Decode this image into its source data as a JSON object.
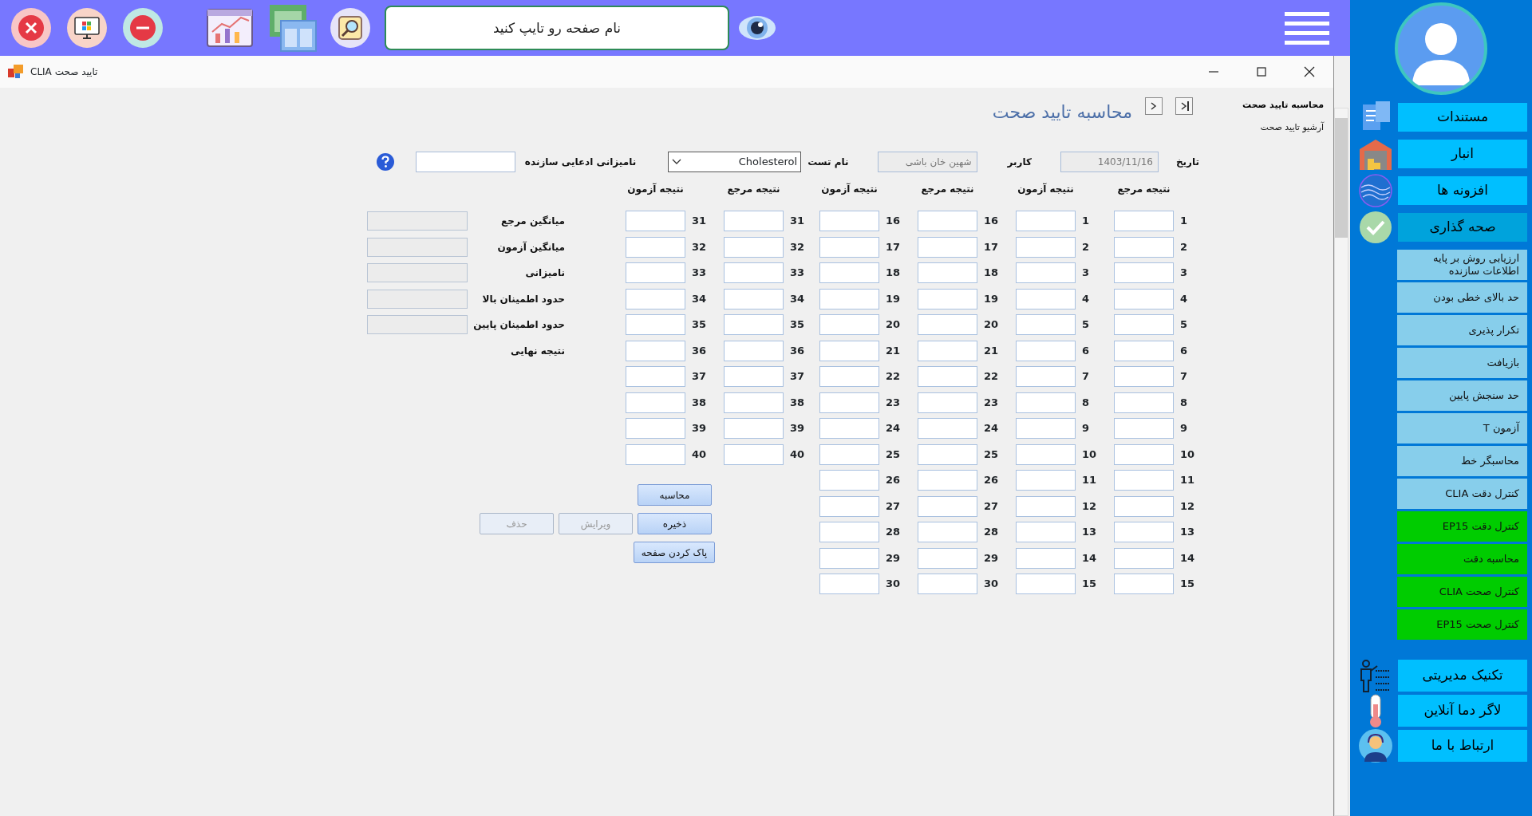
{
  "top_bar": {
    "search": {
      "placeholder": "نام صفحه رو تایپ کنید"
    }
  },
  "window": {
    "title": "تایید صحت CLIA"
  },
  "side_links": [
    {
      "label": "محاسبه تایید صحت",
      "selected": true
    },
    {
      "label": "آرشیو تایید صحت",
      "selected": false
    }
  ],
  "page_title": "محاسبه تایید صحت",
  "fields": [
    {
      "label": "تاریخ",
      "value": "1403/11/16",
      "kind": "text",
      "disabled": true
    },
    {
      "label": "کاربر",
      "value": "شهین خان باشی",
      "kind": "text",
      "disabled": true
    },
    {
      "label": "نام تست",
      "value": "Cholesterol",
      "kind": "dropdown"
    },
    {
      "label": "نامیزانی ادعایی سازنده",
      "kind": "text",
      "disabled": false
    }
  ],
  "result_columns": [
    {
      "header": "نتیجه مرجع",
      "rows": [
        "1",
        "2",
        "3",
        "4",
        "5",
        "6",
        "7",
        "8",
        "9",
        "10",
        "11",
        "12",
        "13",
        "14",
        "15"
      ]
    },
    {
      "header": "نتیجه آزمون",
      "rows": [
        "1",
        "2",
        "3",
        "4",
        "5",
        "6",
        "7",
        "8",
        "9",
        "10",
        "11",
        "12",
        "13",
        "14",
        "15"
      ]
    },
    {
      "header": "نتیجه مرجع",
      "rows": [
        "16",
        "17",
        "18",
        "19",
        "20",
        "21",
        "22",
        "23",
        "24",
        "25",
        "26",
        "27",
        "28",
        "29",
        "30"
      ]
    },
    {
      "header": "نتیجه آزمون",
      "rows": [
        "16",
        "17",
        "18",
        "19",
        "20",
        "21",
        "22",
        "23",
        "24",
        "25",
        "26",
        "27",
        "28",
        "29",
        "30"
      ]
    },
    {
      "header": "نتیجه مرجع",
      "rows": [
        "31",
        "32",
        "33",
        "34",
        "35",
        "36",
        "37",
        "38",
        "39",
        "40"
      ]
    },
    {
      "header": "نتیجه آزمون",
      "rows": [
        "31",
        "32",
        "33",
        "34",
        "35",
        "36",
        "37",
        "38",
        "39",
        "40"
      ]
    }
  ],
  "stats": [
    {
      "label": "میانگین مرجع",
      "kind": "field",
      "disabled": true
    },
    {
      "label": "میانگین آزمون",
      "kind": "field",
      "disabled": true
    },
    {
      "label": "نامیزانی",
      "kind": "field",
      "disabled": true
    },
    {
      "label": "حدود اطمینان بالا",
      "kind": "field",
      "disabled": true
    },
    {
      "label": "حدود اطمینان پایین",
      "kind": "field",
      "disabled": true
    },
    {
      "label": "نتیجه نهایی",
      "kind": "text"
    }
  ],
  "buttons": [
    {
      "label": "محاسبه",
      "disabled": false
    },
    {
      "label": "ذخیره",
      "disabled": false
    },
    {
      "label": "ویرایش",
      "disabled": true
    },
    {
      "label": "حذف",
      "disabled": true
    },
    {
      "label": "پاک کردن صفحه",
      "disabled": false
    }
  ],
  "sidebar": {
    "menu": [
      {
        "label": "مستندات",
        "selected": false
      },
      {
        "label": "انبار",
        "selected": false
      },
      {
        "label": "افزونه ها",
        "selected": false
      },
      {
        "label": "صحه گذاری",
        "selected": true,
        "children": [
          {
            "label": "ارزیابی روش بر پایه اطلاعات سازنده",
            "color": "#87ceeb"
          },
          {
            "label": "حد بالای خطی بودن",
            "color": "#87ceeb"
          },
          {
            "label": "تکرار پذیری",
            "color": "#87ceeb"
          },
          {
            "label": "بازیافت",
            "color": "#87ceeb"
          },
          {
            "label": "حد سنجش پایین",
            "color": "#87ceeb"
          },
          {
            "label": "آزمون T",
            "color": "#87ceeb"
          },
          {
            "label": "محاسبگر خط",
            "color": "#87ceeb"
          },
          {
            "label": "کنترل دقت CLIA",
            "color": "#87ceeb"
          },
          {
            "label": "کنترل دقت EP15",
            "color": "#00cc00"
          },
          {
            "label": "محاسبه دقت",
            "color": "#00cc00"
          },
          {
            "label": "کنترل صحت CLIA",
            "color": "#00cc00"
          },
          {
            "label": "کنترل صحت EP15",
            "color": "#00cc00"
          }
        ]
      }
    ],
    "bottom_items": [
      {
        "label": "تکنیک مدیریتی"
      },
      {
        "label": "لاگر دما آنلاین"
      },
      {
        "label": "ارتباط با ما"
      }
    ]
  }
}
